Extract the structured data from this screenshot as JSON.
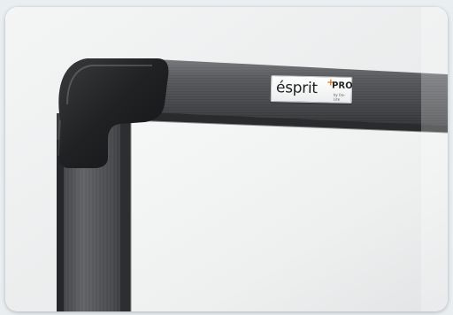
{
  "photo": {
    "subject": "interactive-whiteboard-frame-corner"
  },
  "badge": {
    "brand": "ésprit",
    "plus": "+",
    "pro": "PRO",
    "sub": "by Da-Lite"
  },
  "colors": {
    "frame_dark": "#3b3c3f",
    "frame_light": "#6a6c70",
    "corner_cap": "#1f2022",
    "board_surface": "#f1f2f2",
    "accent_plus": "#e07b1a",
    "page_background": "#e9eef1"
  }
}
